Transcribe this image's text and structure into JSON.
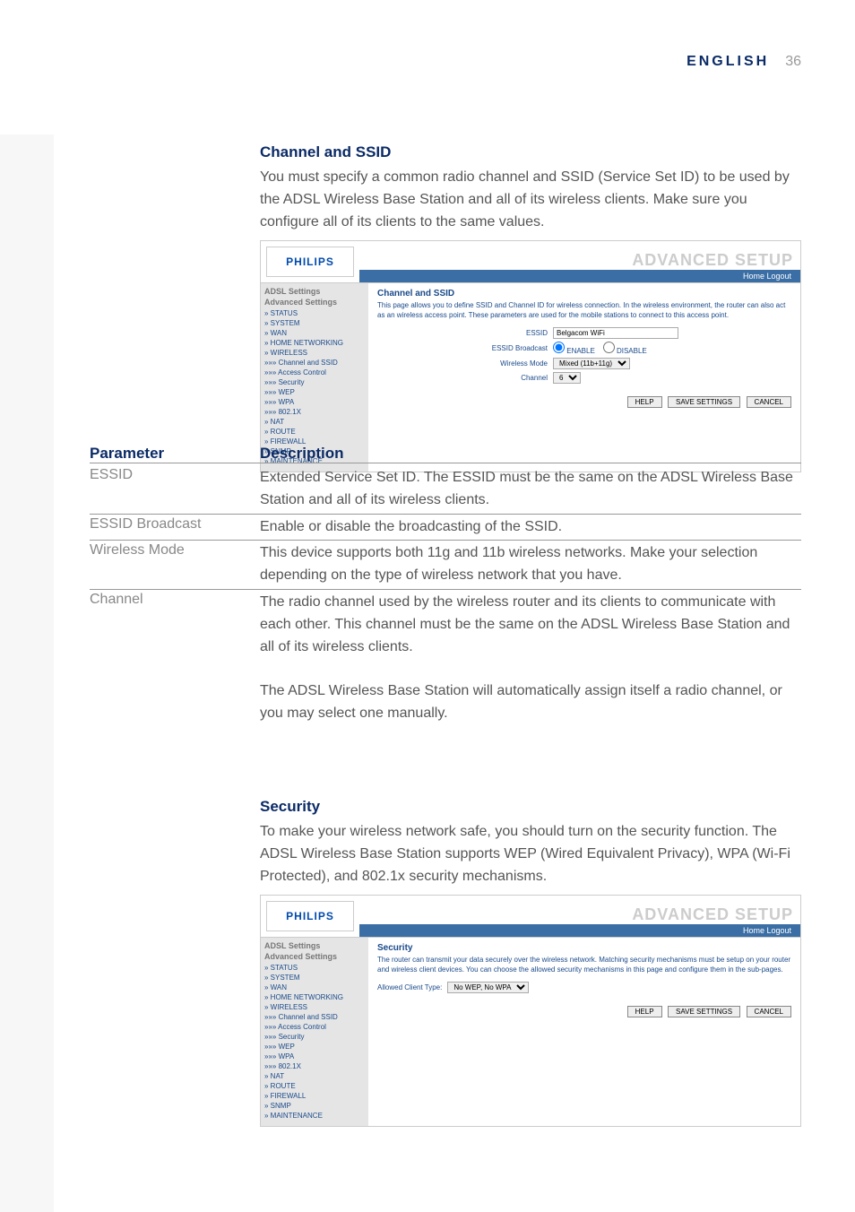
{
  "header": {
    "label": "ENGLISH",
    "page": "36"
  },
  "section_channel": {
    "title": "Channel and SSID",
    "para": "You must specify a common radio channel and SSID (Service Set ID) to be used by the ADSL Wireless Base Station and all of its wireless clients. Make sure you configure all of its clients to the same values."
  },
  "screenshot1": {
    "logo": "PHILIPS",
    "brand": "ADVANCED SETUP",
    "links": "Home  Logout",
    "nav_heading1": "ADSL Settings",
    "nav_heading2": "Advanced Settings",
    "nav_items": [
      "» STATUS",
      "» SYSTEM",
      "» WAN",
      "» HOME NETWORKING",
      "» WIRELESS",
      "»»» Channel and SSID",
      "»»» Access Control",
      "»»» Security",
      "»»» WEP",
      "»»» WPA",
      "»»» 802.1X",
      "» NAT",
      "» ROUTE",
      "» FIREWALL",
      "» SNMP",
      "» MAINTENANCE"
    ],
    "ct_title": "Channel and SSID",
    "ct_desc": "This page allows you to define SSID and Channel ID for wireless connection. In the wireless environment, the router can also act as an wireless access point. These parameters are used for the mobile stations to connect to this access point.",
    "form": {
      "essid_label": "ESSID",
      "essid_value": "Belgacom WiFi",
      "broadcast_label": "ESSID Broadcast",
      "broadcast_enable": "ENABLE",
      "broadcast_disable": "DISABLE",
      "mode_label": "Wireless Mode",
      "mode_value": "Mixed (11b+11g)",
      "channel_label": "Channel",
      "channel_value": "6"
    },
    "buttons": {
      "help": "HELP",
      "save": "SAVE SETTINGS",
      "cancel": "CANCEL"
    }
  },
  "param_table": {
    "head_param": "Parameter",
    "head_desc": "Description",
    "rows": [
      {
        "param": "ESSID",
        "desc": "Extended Service Set ID. The ESSID must be the same on the ADSL Wireless Base Station and all of its wireless clients."
      },
      {
        "param": "ESSID Broadcast",
        "desc": "Enable or disable the broadcasting of the SSID."
      },
      {
        "param": "Wireless Mode",
        "desc": "This device supports both 11g and 11b wireless networks. Make your selection depending on the type of wireless network that you have."
      },
      {
        "param": "Channel",
        "desc": "The radio channel used by the wireless router and its clients to communicate with each other. This channel must be the same on the ADSL Wireless Base Station and all of its wireless clients."
      }
    ],
    "channel_extra": "The ADSL Wireless Base Station will automatically assign itself a radio channel, or you may select one manually."
  },
  "section_security": {
    "title": "Security",
    "para": "To make your wireless network safe, you should turn on the security function. The ADSL Wireless Base Station supports WEP (Wired Equivalent Privacy), WPA (Wi-Fi Protected), and 802.1x security mechanisms."
  },
  "screenshot2": {
    "ct_title": "Security",
    "ct_desc": "The router can transmit your data securely over the wireless network. Matching security mechanisms must be setup on your router and wireless client devices. You can choose the allowed security mechanisms in this page and configure them in the sub-pages.",
    "client_label": "Allowed Client Type:",
    "client_value": "No WEP, No WPA"
  }
}
